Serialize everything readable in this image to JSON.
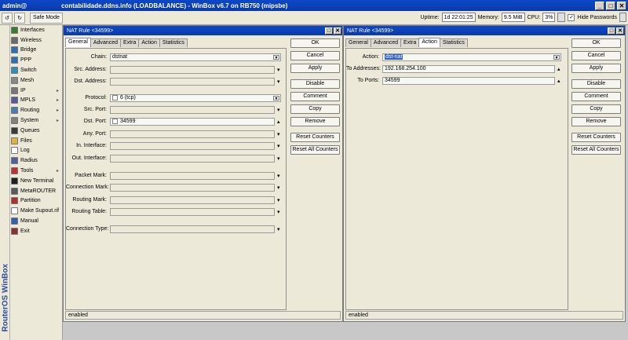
{
  "app": {
    "user": "admin@",
    "title": "contabilidade.ddns.info (LOADBALANCE) - WinBox v6.7 on RB750 (mipsbe)",
    "brand": "RouterOS WinBox"
  },
  "toolbar": {
    "undo": "↺",
    "redo": "↻",
    "safe_mode": "Safe Mode",
    "uptime_label": "Uptime:",
    "uptime": "1d 22:01:25",
    "memory_label": "Memory:",
    "memory": "9.5 MiB",
    "cpu_label": "CPU:",
    "cpu": "3%",
    "hide_passwords": "Hide Passwords",
    "hide_passwords_checked": "✓"
  },
  "sidebar": {
    "items": [
      {
        "label": "Interfaces",
        "icon": "interfaces-icon",
        "color": "#3a7d2c",
        "arrow": ""
      },
      {
        "label": "Wireless",
        "icon": "wireless-icon",
        "color": "#6a6a6a",
        "arrow": ""
      },
      {
        "label": "Bridge",
        "icon": "bridge-icon",
        "color": "#2e6fb8",
        "arrow": ""
      },
      {
        "label": "PPP",
        "icon": "ppp-icon",
        "color": "#2e6fb8",
        "arrow": ""
      },
      {
        "label": "Switch",
        "icon": "switch-icon",
        "color": "#2e8fb8",
        "arrow": ""
      },
      {
        "label": "Mesh",
        "icon": "mesh-icon",
        "color": "#888888",
        "arrow": ""
      },
      {
        "label": "IP",
        "icon": "ip-icon",
        "color": "#777777",
        "arrow": "▸"
      },
      {
        "label": "MPLS",
        "icon": "mpls-icon",
        "color": "#5a5a9a",
        "arrow": "▸"
      },
      {
        "label": "Routing",
        "icon": "routing-icon",
        "color": "#4a7ab8",
        "arrow": "▸"
      },
      {
        "label": "System",
        "icon": "system-icon",
        "color": "#808080",
        "arrow": "▸"
      },
      {
        "label": "Queues",
        "icon": "queues-icon",
        "color": "#3a3a3a",
        "arrow": ""
      },
      {
        "label": "Files",
        "icon": "files-icon",
        "color": "#e0b040",
        "arrow": ""
      },
      {
        "label": "Log",
        "icon": "log-icon",
        "color": "#ffffff",
        "arrow": ""
      },
      {
        "label": "Radius",
        "icon": "radius-icon",
        "color": "#5060a0",
        "arrow": ""
      },
      {
        "label": "Tools",
        "icon": "tools-icon",
        "color": "#c03030",
        "arrow": "▸"
      },
      {
        "label": "New Terminal",
        "icon": "terminal-icon",
        "color": "#202020",
        "arrow": ""
      },
      {
        "label": "MetaROUTER",
        "icon": "metarouter-icon",
        "color": "#5a5a5a",
        "arrow": ""
      },
      {
        "label": "Partition",
        "icon": "partition-icon",
        "color": "#b03030",
        "arrow": ""
      },
      {
        "label": "Make Supout.rif",
        "icon": "supout-icon",
        "color": "#ffffff",
        "arrow": ""
      },
      {
        "label": "Manual",
        "icon": "manual-icon",
        "color": "#3060b0",
        "arrow": ""
      },
      {
        "label": "Exit",
        "icon": "exit-icon",
        "color": "#8a3030",
        "arrow": ""
      }
    ]
  },
  "left_window": {
    "title": "NAT Rule <34599>",
    "tabs": [
      "General",
      "Advanced",
      "Extra",
      "Action",
      "Statistics"
    ],
    "active_tab": "General",
    "fields": {
      "chain": {
        "label": "Chain:",
        "value": "dstnat"
      },
      "src_address": {
        "label": "Src. Address:",
        "value": ""
      },
      "dst_address": {
        "label": "Dst. Address:",
        "value": ""
      },
      "protocol": {
        "label": "Protocol:",
        "value": "6 (tcp)"
      },
      "src_port": {
        "label": "Src. Port:",
        "value": ""
      },
      "dst_port": {
        "label": "Dst. Port:",
        "value": "34599"
      },
      "any_port": {
        "label": "Any. Port:",
        "value": ""
      },
      "in_interface": {
        "label": "In. Interface:",
        "value": ""
      },
      "out_interface": {
        "label": "Out. Interface:",
        "value": ""
      },
      "packet_mark": {
        "label": "Packet Mark:",
        "value": ""
      },
      "connection_mark": {
        "label": "Connection Mark:",
        "value": ""
      },
      "routing_mark": {
        "label": "Routing Mark:",
        "value": ""
      },
      "routing_table": {
        "label": "Routing Table:",
        "value": ""
      },
      "connection_type": {
        "label": "Connection Type:",
        "value": ""
      }
    },
    "status": "enabled"
  },
  "right_window": {
    "title": "NAT Rule <34599>",
    "tabs": [
      "General",
      "Advanced",
      "Extra",
      "Action",
      "Statistics"
    ],
    "active_tab": "Action",
    "fields": {
      "action": {
        "label": "Action:",
        "value": "dst-nat"
      },
      "to_addresses": {
        "label": "To Addresses:",
        "value": "192.168.254.100"
      },
      "to_ports": {
        "label": "To Ports:",
        "value": "34599"
      }
    },
    "status": "enabled"
  },
  "buttons": {
    "ok": "OK",
    "cancel": "Cancel",
    "apply": "Apply",
    "disable": "Disable",
    "comment": "Comment",
    "copy": "Copy",
    "remove": "Remove",
    "reset_counters": "Reset Counters",
    "reset_all_counters": "Reset All Counters"
  },
  "glyphs": {
    "dropdown": "▾",
    "up": "▴",
    "minimize": "□",
    "close": "✕"
  }
}
